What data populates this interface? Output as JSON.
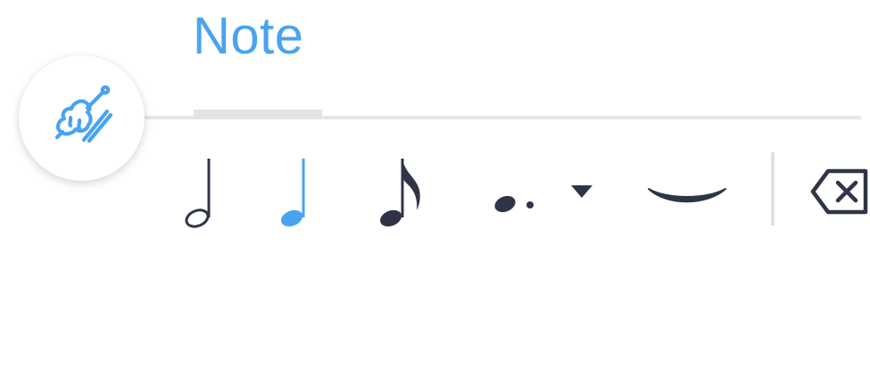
{
  "tab": {
    "title": "Note"
  },
  "toolbar": {
    "items": [
      {
        "name": "half-note",
        "icon": "half-note-icon"
      },
      {
        "name": "quarter-note",
        "icon": "quarter-note-icon",
        "selected": true
      },
      {
        "name": "eighth-note",
        "icon": "eighth-note-icon"
      },
      {
        "name": "dotted-note",
        "icon": "dotted-note-icon",
        "has_dropdown": true
      },
      {
        "name": "tie",
        "icon": "tie-icon"
      },
      {
        "name": "delete",
        "icon": "backspace-icon"
      }
    ]
  },
  "instrument_button": {
    "icon": "violin-icon"
  },
  "colors": {
    "accent": "#4aa3f0",
    "icon_dark": "#2f3547",
    "divider": "#e6e7ea"
  }
}
